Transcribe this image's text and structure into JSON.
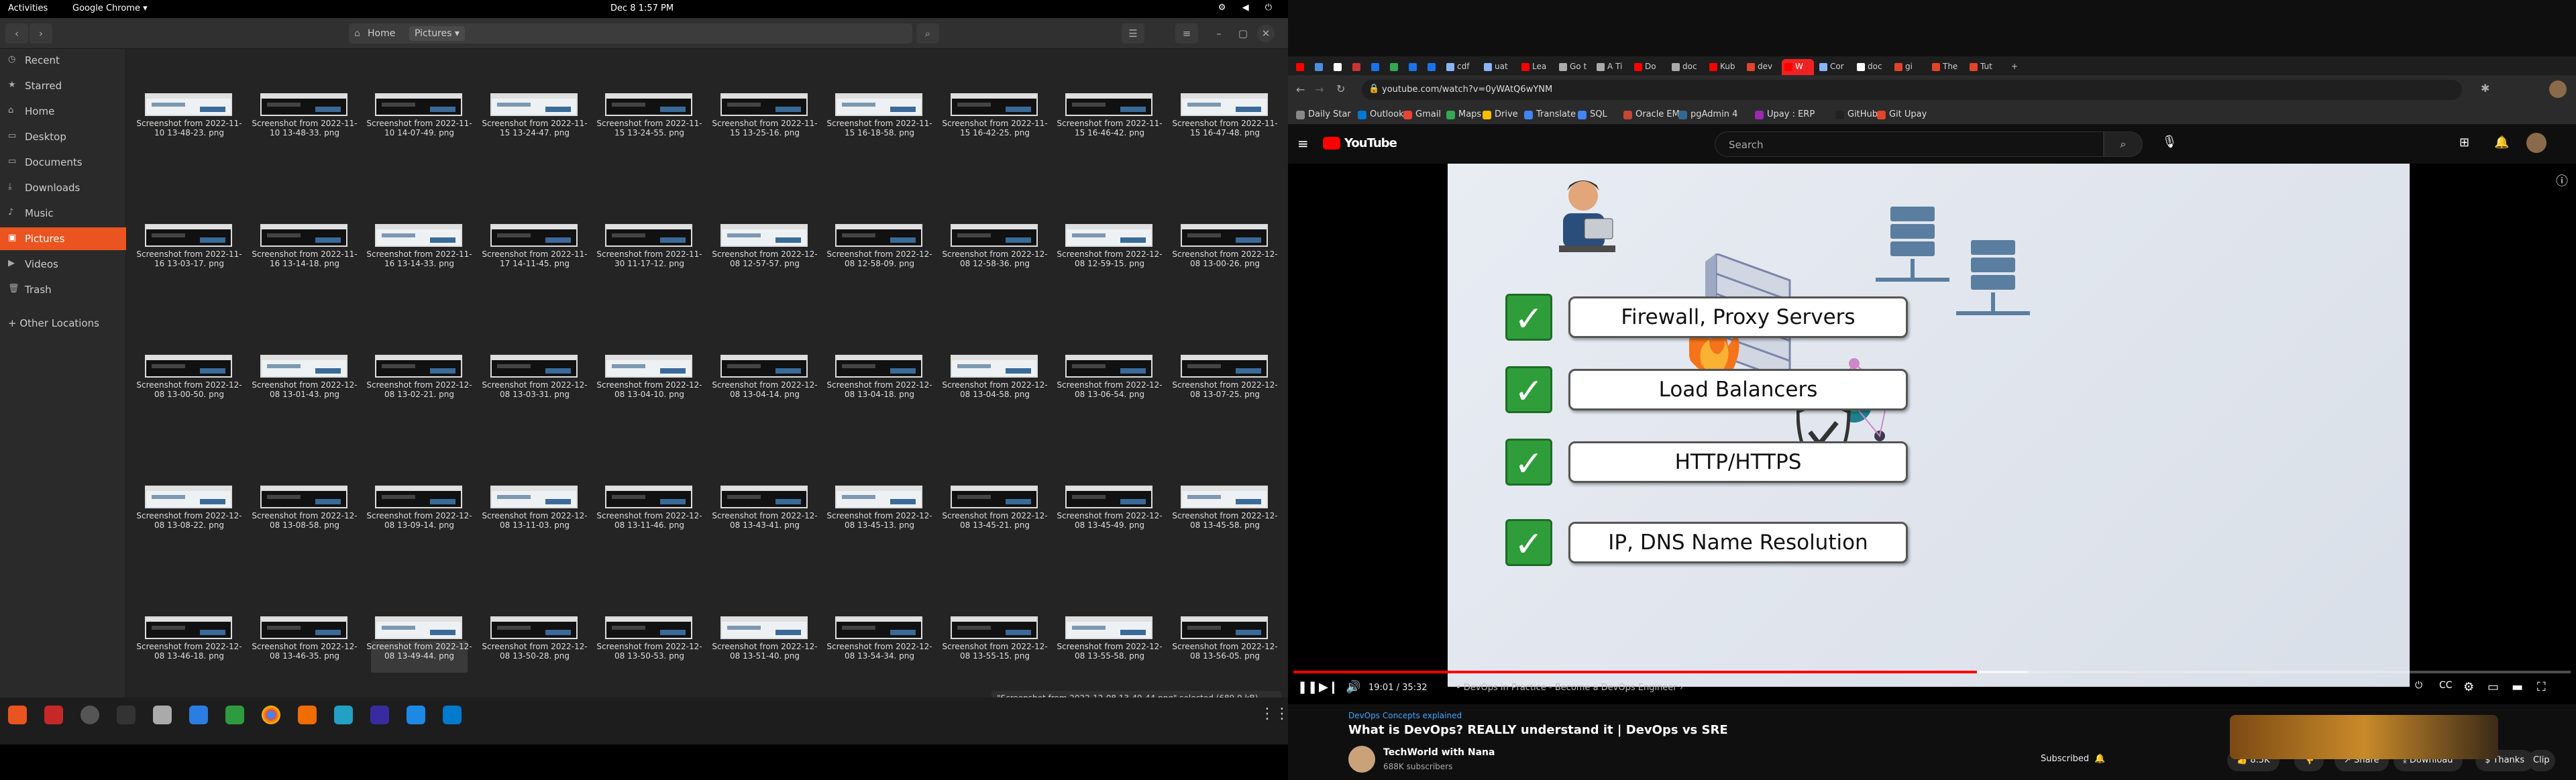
{
  "topbar": {
    "activities": "Activities",
    "app": "Google Chrome ▾",
    "clock": "Dec 8  1:57 PM",
    "tray": "⚙ ◀ ⏻"
  },
  "files": {
    "path": [
      "Home",
      "Pictures"
    ],
    "sidebar": [
      {
        "label": "Recent",
        "icon": "clock-icon"
      },
      {
        "label": "Starred",
        "icon": "star-icon"
      },
      {
        "label": "Home",
        "icon": "home-icon"
      },
      {
        "label": "Desktop",
        "icon": "folder-icon"
      },
      {
        "label": "Documents",
        "icon": "folder-icon"
      },
      {
        "label": "Downloads",
        "icon": "download-icon"
      },
      {
        "label": "Music",
        "icon": "music-icon"
      },
      {
        "label": "Pictures",
        "icon": "image-icon"
      },
      {
        "label": "Videos",
        "icon": "video-icon"
      },
      {
        "label": "Trash",
        "icon": "trash-icon"
      },
      {
        "label": "+ Other Locations",
        "icon": "plus-icon"
      }
    ],
    "files": [
      [
        "2022-11-10 13-48-23.",
        "2022-11-10 13-48-33.",
        "2022-11-10 14-07-49.",
        "2022-11-15 13-24-47.",
        "2022-11-15 13-24-55.",
        "2022-11-15 13-25-16.",
        "2022-11-15 16-18-58.",
        "2022-11-15 16-42-25.",
        "2022-11-15 16-46-42.",
        "2022-11-15 16-47-48."
      ],
      [
        "2022-11-16 13-03-17.",
        "2022-11-16 13-14-18.",
        "2022-11-16 13-14-33.",
        "2022-11-17 14-11-45.",
        "2022-11-30 11-17-12.",
        "2022-12-08 12-57-57.",
        "2022-12-08 12-58-09.",
        "2022-12-08 12-58-36.",
        "2022-12-08 12-59-15.",
        "2022-12-08 13-00-26."
      ],
      [
        "2022-12-08 13-00-50.",
        "2022-12-08 13-01-43.",
        "2022-12-08 13-02-21.",
        "2022-12-08 13-03-31.",
        "2022-12-08 13-04-10.",
        "2022-12-08 13-04-14.",
        "2022-12-08 13-04-18.",
        "2022-12-08 13-04-58.",
        "2022-12-08 13-06-54.",
        "2022-12-08 13-07-25."
      ],
      [
        "2022-12-08 13-08-22.",
        "2022-12-08 13-08-58.",
        "2022-12-08 13-09-14.",
        "2022-12-08 13-11-03.",
        "2022-12-08 13-11-46.",
        "2022-12-08 13-43-41.",
        "2022-12-08 13-45-13.",
        "2022-12-08 13-45-21.",
        "2022-12-08 13-45-49.",
        "2022-12-08 13-45-58."
      ],
      [
        "2022-12-08 13-46-18.",
        "2022-12-08 13-46-35.",
        "2022-12-08 13-49-44.",
        "2022-12-08 13-50-28.",
        "2022-12-08 13-50-53.",
        "2022-12-08 13-51-40.",
        "2022-12-08 13-54-34.",
        "2022-12-08 13-55-15.",
        "2022-12-08 13-55-58.",
        "2022-12-08 13-56-05."
      ]
    ],
    "file_prefix": "Screenshot from",
    "file_ext": "png",
    "status": "\"Screenshot from 2022-12-08 13-49-44.png\" selected (689.9 kB)"
  },
  "browser": {
    "tabs": [
      {
        "label": "",
        "color": "#ff0000"
      },
      {
        "label": "",
        "color": "#4a90e2"
      },
      {
        "label": "",
        "color": "#ffffff"
      },
      {
        "label": "",
        "color": "#cc3333"
      },
      {
        "label": "",
        "color": "#1a73e8"
      },
      {
        "label": "",
        "color": "#34a853"
      },
      {
        "label": "",
        "color": "#1a73e8"
      },
      {
        "label": "",
        "color": "#1a73e8"
      },
      {
        "label": "cdf",
        "color": "#8ab4f8"
      },
      {
        "label": "uat",
        "color": "#8ab4f8"
      },
      {
        "label": "Lea",
        "color": "#ff0000"
      },
      {
        "label": "Go t",
        "color": "#aaaaaa"
      },
      {
        "label": "A Ti",
        "color": "#aaaaaa"
      },
      {
        "label": "Do",
        "color": "#ff0000"
      },
      {
        "label": "doc",
        "color": "#aaaaaa"
      },
      {
        "label": "Kub",
        "color": "#ff0000"
      },
      {
        "label": "dev",
        "color": "#e24329"
      },
      {
        "label": "W",
        "color": "#ff0000",
        "active": true
      },
      {
        "label": "Cor",
        "color": "#8ab4f8"
      },
      {
        "label": "doc",
        "color": "#ffffff"
      },
      {
        "label": "gi",
        "color": "#e24329"
      },
      {
        "label": "The",
        "color": "#e24329"
      },
      {
        "label": "Tut",
        "color": "#e24329"
      }
    ],
    "url": "youtube.com/watch?v=0yWAtQ6wYNM",
    "bookmarks": [
      {
        "label": "Daily Star",
        "color": "#888888"
      },
      {
        "label": "Outlook",
        "color": "#0078d4"
      },
      {
        "label": "Gmail",
        "color": "#ea4335"
      },
      {
        "label": "Maps",
        "color": "#34a853"
      },
      {
        "label": "Drive",
        "color": "#fbbc04"
      },
      {
        "label": "Translate",
        "color": "#4285f4"
      },
      {
        "label": "SQL",
        "color": "#4285f4"
      },
      {
        "label": "Oracle EM",
        "color": "#c74634"
      },
      {
        "label": "pgAdmin 4",
        "color": "#336791"
      },
      {
        "label": "Upay : ERP",
        "color": "#9c27b0"
      },
      {
        "label": "GitHub",
        "color": "#222222"
      },
      {
        "label": "Git Upay",
        "color": "#e24329"
      }
    ],
    "youtube": {
      "logo": "YouTube",
      "search_placeholder": "Search",
      "video_items": [
        "Firewall, Proxy Servers",
        "Load Balancers",
        "HTTP/HTTPS",
        "IP, DNS Name Resolution"
      ],
      "time": "19:01 / 35:32",
      "chapter": "• DevOps in Practice - Become a DevOps Engineer  ›",
      "progress_fraction": 0.535,
      "buffer_fraction": 0.575,
      "hashtag": "DevOps Concepts explained",
      "title": "What is DevOps? REALLY understand it | DevOps vs SRE",
      "channel": "TechWorld with Nana",
      "subscribers": "688K subscribers",
      "subscribe_label": "Subscribed",
      "likes": "8.5K",
      "actions": [
        "Share",
        "Download",
        "Thanks",
        "Clip",
        "···"
      ]
    }
  }
}
